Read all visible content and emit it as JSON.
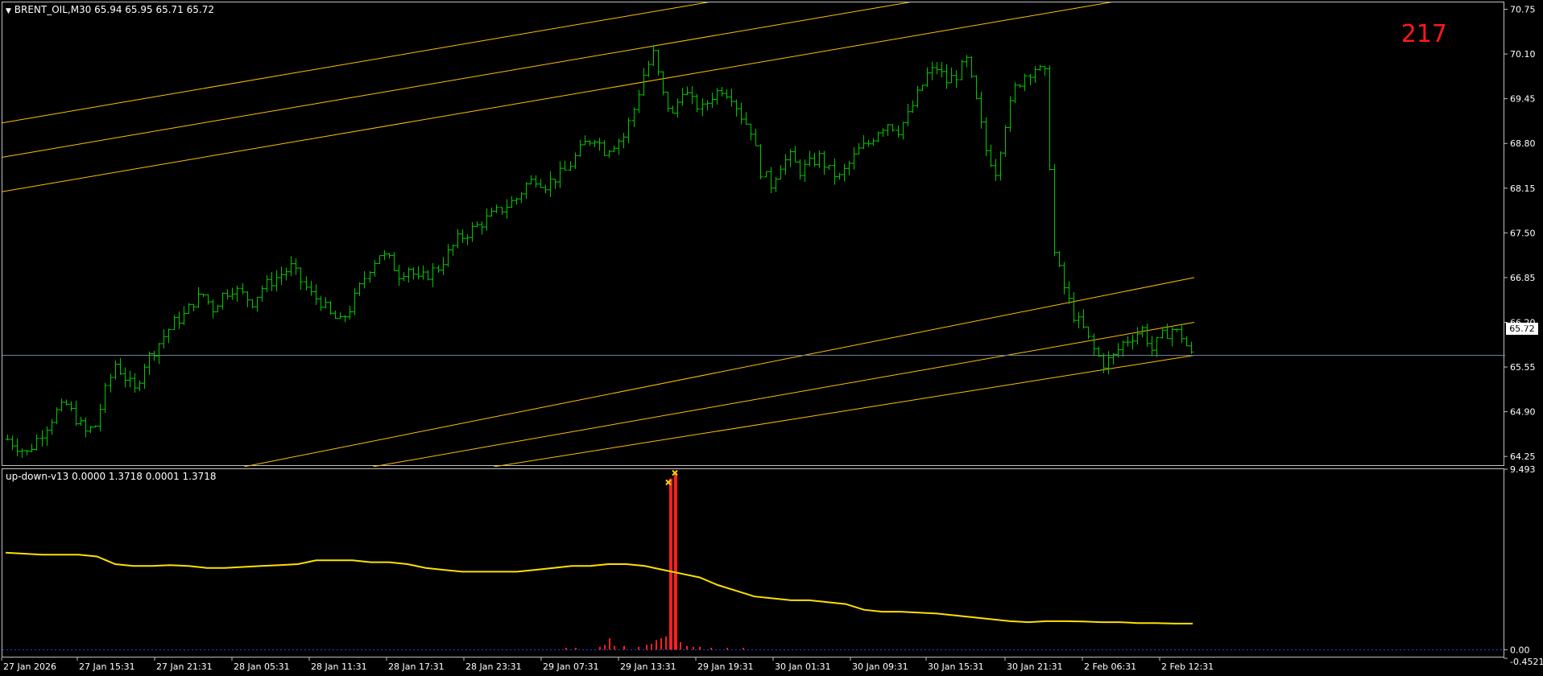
{
  "symbol_header": "BRENT_OIL,M30  65.94 65.95 65.71 65.72",
  "indicator_header": "up-down-v13 0.0000 1.3718 0.0001 1.3718",
  "counter": "217",
  "current_price_tag": "65.72",
  "price_axis": [
    "70.75",
    "70.10",
    "69.45",
    "68.80",
    "68.15",
    "67.50",
    "66.85",
    "66.20",
    "65.55",
    "64.90",
    "64.25"
  ],
  "indicator_axis": [
    "9.493",
    "0.00",
    "-0.4521"
  ],
  "time_axis": [
    "27 Jan 2026",
    "27 Jan 15:31",
    "27 Jan 21:31",
    "28 Jan 05:31",
    "28 Jan 11:31",
    "28 Jan 17:31",
    "28 Jan 23:31",
    "29 Jan 07:31",
    "29 Jan 13:31",
    "29 Jan 19:31",
    "30 Jan 01:31",
    "30 Jan 09:31",
    "30 Jan 15:31",
    "30 Jan 21:31",
    "2 Feb 06:31",
    "2 Feb 12:31"
  ],
  "colors": {
    "background": "#000000",
    "bars": "#00c800",
    "channel": "#ffc000",
    "indicator_line": "#ffe000",
    "histogram": "#ff2020",
    "counter": "#ff1a1a",
    "grid_border": "#c0c0c0"
  },
  "chart_data": {
    "type": "ohlc",
    "symbol": "BRENT_OIL",
    "timeframe": "M30",
    "ylim": [
      64.1,
      70.85
    ],
    "close_path": [
      64.5,
      64.4,
      64.3,
      64.5,
      64.7,
      64.9,
      65.0,
      64.8,
      64.6,
      64.7,
      65.2,
      65.6,
      65.4,
      65.2,
      65.6,
      65.8,
      66.0,
      66.2,
      66.3,
      66.5,
      66.6,
      66.4,
      66.6,
      66.7,
      66.6,
      66.5,
      66.7,
      66.8,
      66.9,
      67.0,
      66.8,
      66.6,
      66.5,
      66.3,
      66.2,
      66.4,
      66.7,
      67.0,
      67.2,
      67.1,
      66.9,
      67.0,
      66.8,
      66.9,
      67.0,
      67.2,
      67.4,
      67.5,
      67.6,
      67.7,
      67.8,
      67.9,
      68.0,
      68.2,
      68.3,
      68.2,
      68.3,
      68.4,
      68.6,
      68.8,
      68.9,
      68.7,
      68.8,
      68.9,
      69.3,
      69.8,
      70.1,
      69.5,
      69.2,
      69.6,
      69.4,
      69.3,
      69.5,
      69.6,
      69.5,
      69.2,
      69.0,
      68.4,
      68.2,
      68.5,
      68.6,
      68.4,
      68.5,
      68.6,
      68.4,
      68.3,
      68.5,
      68.7,
      68.8,
      69.0,
      69.1,
      69.0,
      69.2,
      69.5,
      69.8,
      69.9,
      69.7,
      69.8,
      70.0,
      69.4,
      68.7,
      68.4,
      69.1,
      69.6,
      69.8,
      69.9,
      69.8,
      67.2,
      66.7,
      66.3,
      66.1,
      65.8,
      65.6,
      65.7,
      65.9,
      66.0,
      66.1,
      65.8,
      66.0,
      66.1,
      66.0,
      65.72
    ],
    "channel_upper": [
      [
        0,
        69.1
      ],
      [
        1850,
        72.8
      ]
    ],
    "channel_middle": [
      [
        0,
        68.6
      ],
      [
        1850,
        72.3
      ]
    ],
    "channel_lower": [
      [
        0,
        68.1
      ],
      [
        1850,
        71.8
      ]
    ],
    "channel2_upper": [
      [
        300,
        64.1
      ],
      [
        1480,
        66.85
      ]
    ],
    "channel2_middle": [
      [
        460,
        64.1
      ],
      [
        1480,
        66.2
      ]
    ],
    "channel2_lower": [
      [
        610,
        64.1
      ],
      [
        1480,
        65.72
      ]
    ],
    "indicator_ylim": [
      -0.4521,
      9.493
    ],
    "indicator_line": [
      5.1,
      5.05,
      5.0,
      5.0,
      5.0,
      4.9,
      4.5,
      4.4,
      4.4,
      4.45,
      4.4,
      4.3,
      4.3,
      4.35,
      4.4,
      4.45,
      4.5,
      4.7,
      4.7,
      4.7,
      4.6,
      4.6,
      4.5,
      4.3,
      4.2,
      4.1,
      4.1,
      4.1,
      4.1,
      4.2,
      4.3,
      4.4,
      4.4,
      4.5,
      4.5,
      4.4,
      4.2,
      4.0,
      3.8,
      3.4,
      3.1,
      2.8,
      2.7,
      2.6,
      2.6,
      2.5,
      2.4,
      2.1,
      2.0,
      2.0,
      1.95,
      1.9,
      1.8,
      1.7,
      1.6,
      1.5,
      1.45,
      1.5,
      1.5,
      1.48,
      1.45,
      1.45,
      1.4,
      1.4,
      1.37,
      1.37
    ]
  }
}
